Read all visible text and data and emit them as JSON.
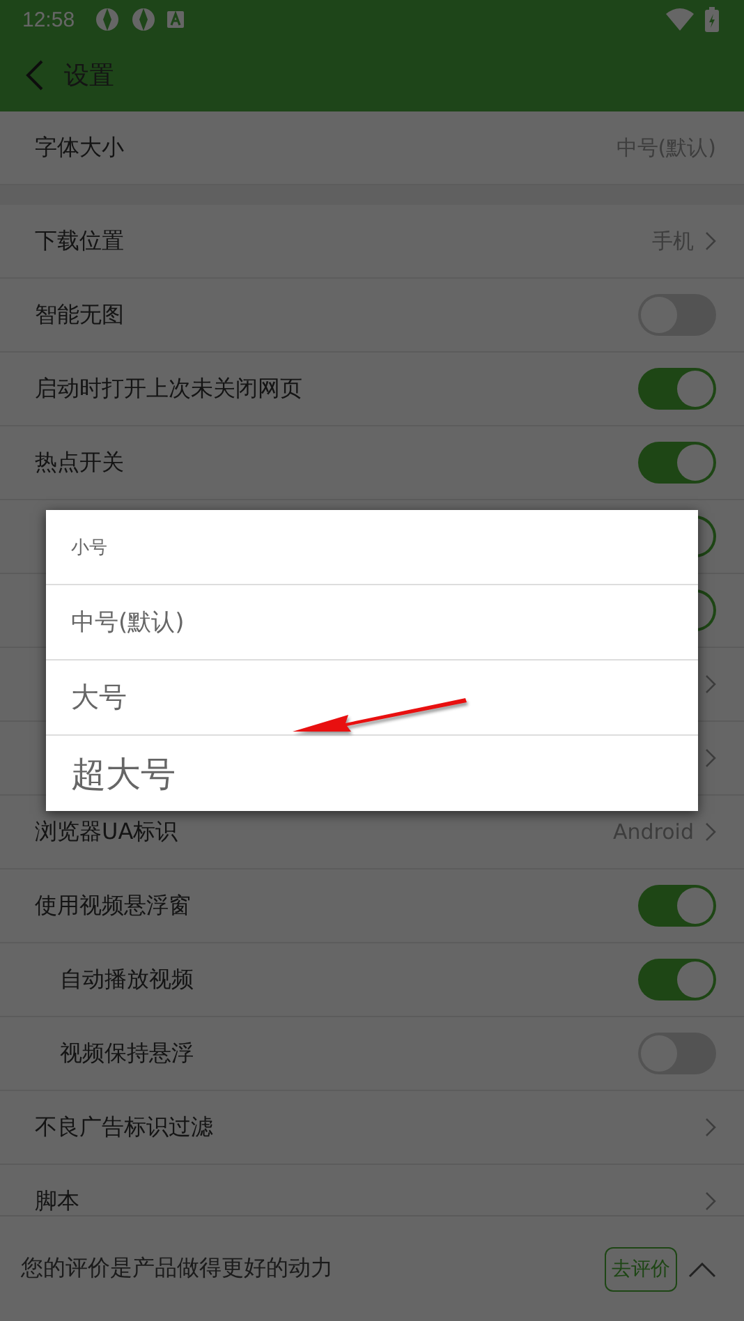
{
  "status_bar": {
    "time": "12:58"
  },
  "header": {
    "title": "设置"
  },
  "groups": [
    [
      {
        "kind": "value",
        "label": "字体大小",
        "value": "中号(默认)"
      }
    ],
    [
      {
        "kind": "link",
        "label": "下载位置",
        "value": "手机"
      },
      {
        "kind": "switch",
        "label": "智能无图",
        "on": false
      },
      {
        "kind": "switch",
        "label": "启动时打开上次未关闭网页",
        "on": true
      },
      {
        "kind": "switch",
        "label": "热点开关",
        "on": true
      },
      {
        "kind": "switch",
        "on": true
      },
      {
        "kind": "switch",
        "on": true
      },
      {
        "kind": "link"
      },
      {
        "kind": "link"
      },
      {
        "kind": "link",
        "label": "浏览器UA标识",
        "value": "Android"
      },
      {
        "kind": "switch",
        "label": "使用视频悬浮窗",
        "on": true,
        "children": [
          {
            "kind": "switch",
            "label": "自动播放视频",
            "on": true
          },
          {
            "kind": "switch",
            "label": "视频保持悬浮",
            "on": false
          }
        ]
      },
      {
        "kind": "link",
        "label": "不良广告标识过滤"
      },
      {
        "kind": "link",
        "label": "脚本"
      }
    ]
  ],
  "bottom_bar": {
    "message": "您的评价是产品做得更好的动力",
    "button": "去评价"
  },
  "dialog": {
    "options": [
      "小号",
      "中号(默认)",
      "大号",
      "超大号"
    ]
  }
}
